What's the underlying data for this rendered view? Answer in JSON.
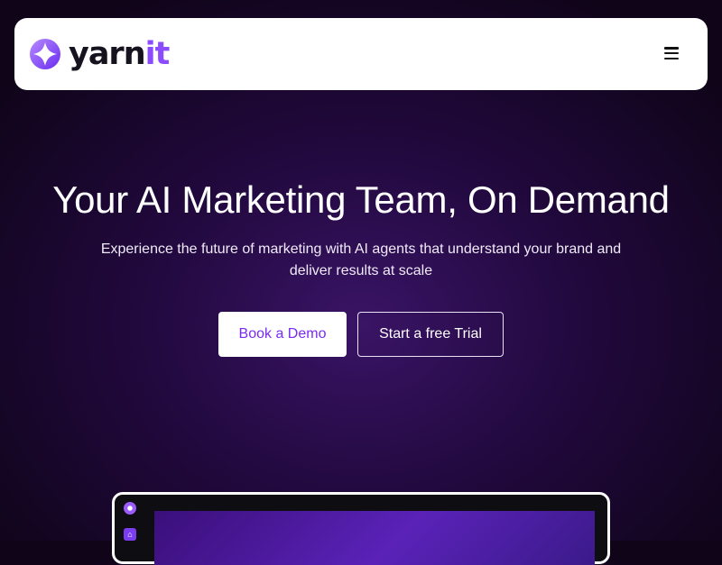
{
  "brand": {
    "name_main": "yarn",
    "name_accent": "it"
  },
  "nav": {
    "menu_icon": "hamburger-menu-icon"
  },
  "hero": {
    "title": "Your AI Marketing Team, On Demand",
    "subtitle": "Experience the future of marketing with AI agents that understand your brand and deliver results at scale",
    "primary_cta": "Book a Demo",
    "secondary_cta": "Start a free Trial"
  },
  "preview": {
    "home_icon": "⌂"
  },
  "colors": {
    "accent": "#8b4bff",
    "background": "#1a0730",
    "cta_text": "#7a2bf0"
  }
}
